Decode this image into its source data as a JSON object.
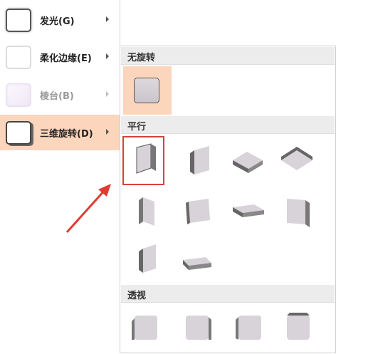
{
  "left_menu": {
    "items": [
      {
        "label": "发光(G)",
        "icon": "glow-preset-icon",
        "active": false,
        "disabled": false
      },
      {
        "label": "柔化边缘(E)",
        "icon": "soft-edges-icon",
        "active": false,
        "disabled": false
      },
      {
        "label": "棱台(B)",
        "icon": "bevel-icon",
        "active": false,
        "disabled": true
      },
      {
        "label": "三维旋转(D)",
        "icon": "3d-rotation-icon",
        "active": true,
        "disabled": false
      }
    ]
  },
  "gallery": {
    "sections": [
      {
        "title": "无旋转"
      },
      {
        "title": "平行"
      },
      {
        "title": "透视"
      }
    ]
  },
  "colors": {
    "active_bg": "#fcd5bd",
    "highlight_border": "#d9413a",
    "arrow": "#e03c31"
  }
}
